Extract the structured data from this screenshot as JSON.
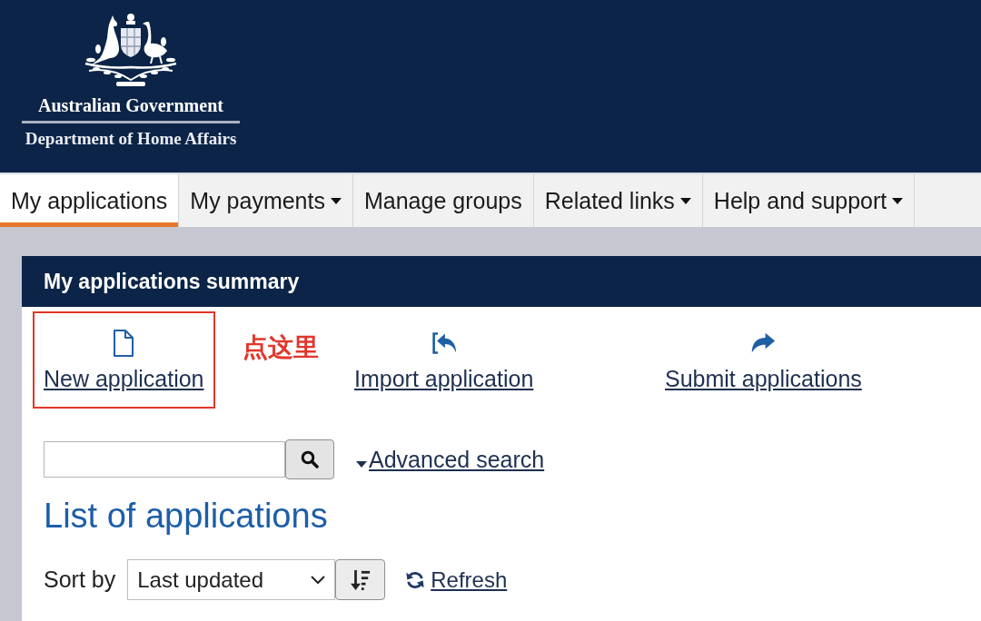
{
  "header": {
    "agency": "Australian Government",
    "department": "Department of Home Affairs"
  },
  "nav": {
    "tabs": [
      {
        "label": "My applications",
        "selected": true,
        "dropdown": false
      },
      {
        "label": "My payments",
        "selected": false,
        "dropdown": true
      },
      {
        "label": "Manage groups",
        "selected": false,
        "dropdown": false
      },
      {
        "label": "Related links",
        "selected": false,
        "dropdown": true
      },
      {
        "label": "Help and support",
        "selected": false,
        "dropdown": true
      }
    ]
  },
  "summary": {
    "title": "My applications summary",
    "actions": [
      {
        "label": "New application",
        "kind": "new",
        "highlighted": true
      },
      {
        "label": "Import application",
        "kind": "import",
        "highlighted": false
      },
      {
        "label": "Submit applications",
        "kind": "submit",
        "highlighted": false
      }
    ],
    "callout": "点这里"
  },
  "search": {
    "advanced_link": "Advanced search"
  },
  "list": {
    "heading": "List of applications",
    "sort_label": "Sort by",
    "sort_value": "Last updated",
    "refresh": "Refresh"
  }
}
